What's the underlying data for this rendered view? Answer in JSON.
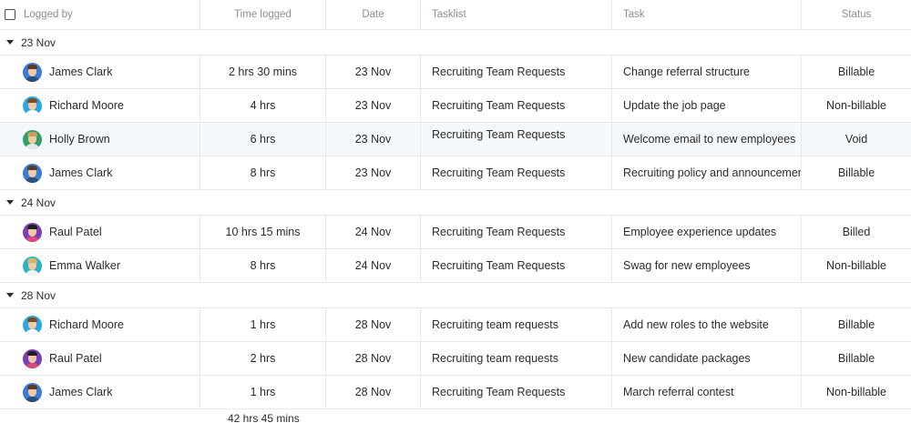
{
  "columns": {
    "logged_by": "Logged by",
    "time_logged": "Time logged",
    "date": "Date",
    "tasklist": "Tasklist",
    "task": "Task",
    "status": "Status"
  },
  "groups": [
    {
      "label": "23 Nov",
      "rows": [
        {
          "name": "James Clark",
          "time": "2 hrs 30 mins",
          "date": "23 Nov",
          "tasklist": "Recruiting Team Requests",
          "task": "Change referral structure",
          "status": "Billable",
          "avatar": {
            "bg": "#3a7bd5",
            "hair": "#5a3a22",
            "shirt": "#2c4f7c"
          }
        },
        {
          "name": "Richard Moore",
          "time": "4 hrs",
          "date": "23 Nov",
          "tasklist": "Recruiting Team Requests",
          "task": "Update the job page",
          "status": "Non-billable",
          "avatar": {
            "bg": "#29a8e0",
            "hair": "#7b4a2a",
            "shirt": "#ffffff"
          }
        },
        {
          "name": "Holly Brown",
          "time": "6 hrs",
          "date": "23 Nov",
          "tasklist": "Recruiting Team Requests",
          "task": "Welcome email to new employees",
          "status": "Void",
          "avatar": {
            "bg": "#2e9e6b",
            "hair": "#c9a35c",
            "shirt": "#e8e8e8"
          }
        },
        {
          "name": "James Clark",
          "time": "8 hrs",
          "date": "23 Nov",
          "tasklist": "Recruiting Team Requests",
          "task": "Recruiting policy and announcement",
          "status": "Billable",
          "avatar": {
            "bg": "#3a7bd5",
            "hair": "#5a3a22",
            "shirt": "#2c4f7c"
          }
        }
      ]
    },
    {
      "label": "24 Nov",
      "rows": [
        {
          "name": "Raul Patel",
          "time": "10 hrs 15 mins",
          "date": "24 Nov",
          "tasklist": "Recruiting Team Requests",
          "task": "Employee experience updates",
          "status": "Billed",
          "avatar": {
            "bg": "#7b3fb5",
            "hair": "#1e1e1e",
            "shirt": "#d94c7a"
          }
        },
        {
          "name": "Emma Walker",
          "time": "8 hrs",
          "date": "24 Nov",
          "tasklist": "Recruiting Team Requests",
          "task": "Swag for new employees",
          "status": "Non-billable",
          "avatar": {
            "bg": "#2ab5c0",
            "hair": "#d8b26a",
            "shirt": "#f3f3f3"
          }
        }
      ]
    },
    {
      "label": "28 Nov",
      "rows": [
        {
          "name": "Richard Moore",
          "time": "1 hrs",
          "date": "28 Nov",
          "tasklist": "Recruiting team requests",
          "task": "Add new roles to the website",
          "status": "Billable",
          "avatar": {
            "bg": "#29a8e0",
            "hair": "#7b4a2a",
            "shirt": "#ffffff"
          }
        },
        {
          "name": "Raul Patel",
          "time": "2 hrs",
          "date": "28 Nov",
          "tasklist": "Recruiting team requests",
          "task": "New candidate packages",
          "status": "Billable",
          "avatar": {
            "bg": "#7b3fb5",
            "hair": "#1e1e1e",
            "shirt": "#d94c7a"
          }
        },
        {
          "name": "James Clark",
          "time": "1 hrs",
          "date": "28 Nov",
          "tasklist": "Recruiting Team Requests",
          "task": "March referral contest",
          "status": "Non-billable",
          "avatar": {
            "bg": "#3a7bd5",
            "hair": "#5a3a22",
            "shirt": "#2c4f7c"
          }
        }
      ]
    }
  ],
  "total": "42 hrs 45 mins",
  "colors": {
    "border": "#e6e8eb",
    "header_text": "#8a8f96",
    "highlight_row": "#f5f9fc"
  }
}
